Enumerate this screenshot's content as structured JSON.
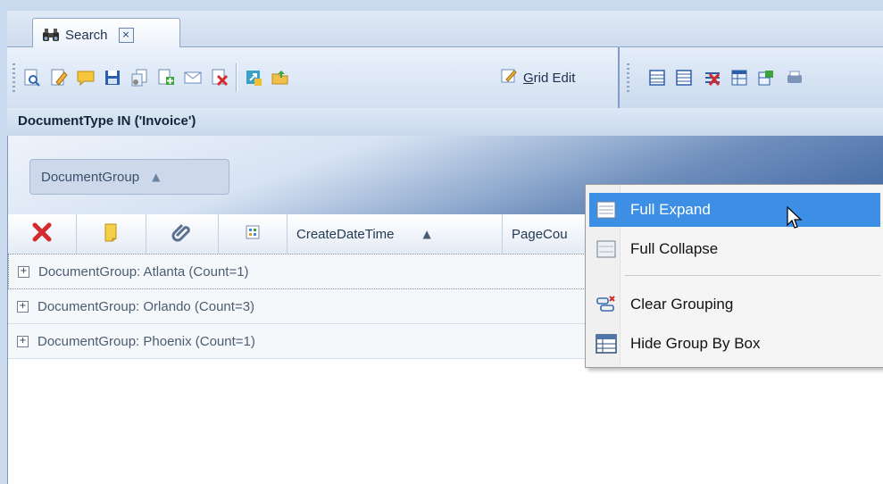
{
  "tab": {
    "label": "Search",
    "close_glyph": "×",
    "icon": "binoculars-icon"
  },
  "toolbar": {
    "grid_edit_prefix": "G",
    "grid_edit_rest": "rid Edit",
    "buttons": [
      "find-document-icon",
      "edit-document-icon",
      "comment-icon",
      "save-icon",
      "copy-documents-icon",
      "add-page-icon",
      "email-icon",
      "delete-document-icon",
      "export-icon",
      "open-folder-icon"
    ],
    "right_buttons": [
      "list-view-icon",
      "details-view-icon",
      "remove-columns-icon",
      "table-icon",
      "layout-icon",
      "print-icon"
    ]
  },
  "filter": {
    "text": "DocumentType IN ('Invoice')"
  },
  "groupby": {
    "chip_label": "DocumentGroup",
    "sort_glyph": "▲"
  },
  "grid": {
    "columns": [
      {
        "kind": "icon",
        "icon": "delete-x-icon"
      },
      {
        "kind": "icon",
        "icon": "note-icon"
      },
      {
        "kind": "icon",
        "icon": "attachment-icon"
      },
      {
        "kind": "icon",
        "icon": "grid-icon"
      },
      {
        "kind": "text",
        "label": "CreateDateTime",
        "sort_glyph": "▲"
      },
      {
        "kind": "text",
        "label": "PageCou"
      }
    ],
    "rows": [
      {
        "label": "DocumentGroup: Atlanta (Count=1)"
      },
      {
        "label": "DocumentGroup: Orlando (Count=3)"
      },
      {
        "label": "DocumentGroup: Phoenix (Count=1)"
      }
    ],
    "expand_glyph": "+"
  },
  "menu": {
    "items": [
      {
        "label": "Full Expand",
        "icon": "full-expand-icon",
        "highlighted": true
      },
      {
        "label": "Full Collapse",
        "icon": "full-collapse-icon",
        "highlighted": false
      },
      {
        "label": "Clear Grouping",
        "icon": "clear-grouping-icon",
        "highlighted": false
      },
      {
        "label": "Hide Group By Box",
        "icon": "hide-group-by-box-icon",
        "highlighted": false
      }
    ]
  },
  "colors": {
    "accent": "#3d8fe6",
    "frame": "#c9d9ee",
    "delete": "#d12b2b"
  }
}
